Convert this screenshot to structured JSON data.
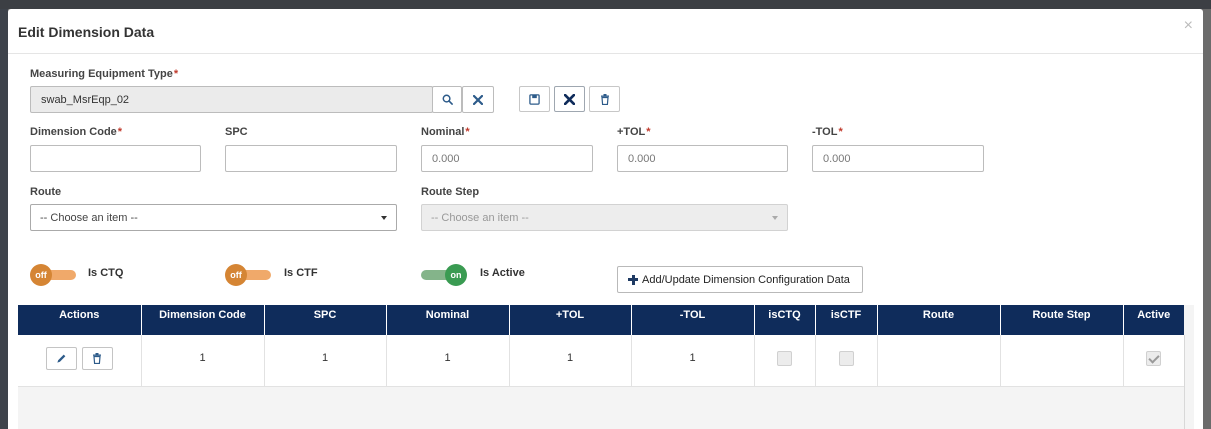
{
  "modal": {
    "title": "Edit Dimension Data",
    "close_glyph": "×"
  },
  "equipment": {
    "label": "Measuring Equipment Type",
    "required_mark": "*",
    "value": "swab_MsrEqp_02"
  },
  "fields": {
    "dimension_code": {
      "label": "Dimension Code",
      "required_mark": "*",
      "value": ""
    },
    "spc": {
      "label": "SPC",
      "value": ""
    },
    "nominal": {
      "label": "Nominal",
      "required_mark": "*",
      "placeholder": "0.000"
    },
    "plus_tol": {
      "label": "+TOL",
      "required_mark": "*",
      "placeholder": "0.000"
    },
    "minus_tol": {
      "label": "-TOL",
      "required_mark": "*",
      "placeholder": "0.000"
    },
    "route": {
      "label": "Route",
      "selected": "-- Choose an item --"
    },
    "route_step": {
      "label": "Route Step",
      "selected": "-- Choose an item --"
    }
  },
  "toggles": {
    "is_ctq": {
      "label": "Is CTQ",
      "state_text": "off"
    },
    "is_ctf": {
      "label": "Is CTF",
      "state_text": "off"
    },
    "is_active": {
      "label": "Is Active",
      "state_text": "on"
    }
  },
  "add_button_label": "Add/Update Dimension Configuration Data",
  "grid": {
    "columns": [
      "Actions",
      "Dimension Code",
      "SPC",
      "Nominal",
      "+TOL",
      "-TOL",
      "isCTQ",
      "isCTF",
      "Route",
      "Route Step",
      "Active"
    ],
    "rows": [
      {
        "dimension_code": "1",
        "spc": "1",
        "nominal": "1",
        "plus_tol": "1",
        "minus_tol": "1",
        "route": "",
        "route_step": ""
      }
    ]
  },
  "colors": {
    "grid_header": "#0f2c5b",
    "toggle_off": "#d58534",
    "toggle_on": "#3a9b52",
    "icon_blue": "#2d5b8a"
  },
  "icons": {
    "search": "search-icon",
    "clear": "close-icon",
    "save": "save-icon",
    "cancel": "close-icon",
    "delete": "trash-icon",
    "edit": "pencil-icon",
    "add": "plus-icon"
  }
}
